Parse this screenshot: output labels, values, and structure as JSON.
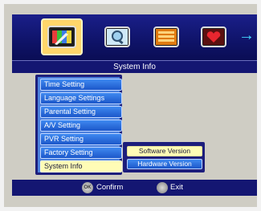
{
  "header": {
    "icons": [
      {
        "name": "system-settings-icon",
        "selected": true
      },
      {
        "name": "search-icon",
        "selected": false
      },
      {
        "name": "program-guide-icon",
        "selected": false
      },
      {
        "name": "favorites-icon",
        "selected": false
      }
    ],
    "next_icon": "arrow-right-icon",
    "title": "System Info"
  },
  "menu": {
    "items": [
      {
        "label": "Time Setting",
        "active": false
      },
      {
        "label": "Language Settings",
        "active": false
      },
      {
        "label": "Parental Setting",
        "active": false
      },
      {
        "label": "A/V Setting",
        "active": false
      },
      {
        "label": "PVR Setting",
        "active": false
      },
      {
        "label": "Factory Setting",
        "active": false
      },
      {
        "label": "System Info",
        "active": true
      }
    ]
  },
  "submenu": {
    "items": [
      {
        "label": "Software Version",
        "active": true
      },
      {
        "label": "Hardware Version",
        "active": false
      }
    ]
  },
  "footer": {
    "ok_text": "OK",
    "confirm_label": "Confirm",
    "exit_label": "Exit"
  },
  "colors": {
    "bar_blue": "#141672",
    "menu_blue": "#2f6fe0",
    "highlight": "#fffcb6",
    "background": "#cfcdc4"
  }
}
